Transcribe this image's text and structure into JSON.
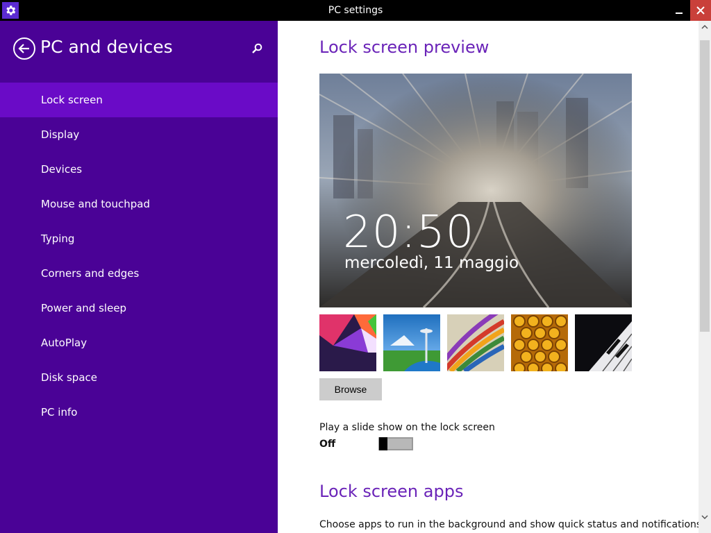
{
  "window": {
    "title": "PC settings",
    "icons": {
      "app": "gear-icon",
      "minimize": "minimize-icon",
      "close": "close-icon"
    }
  },
  "sidebar": {
    "title": "PC and devices",
    "back_icon": "back-arrow-icon",
    "search_icon": "search-icon",
    "items": [
      {
        "label": "Lock screen",
        "active": true
      },
      {
        "label": "Display"
      },
      {
        "label": "Devices"
      },
      {
        "label": "Mouse and touchpad"
      },
      {
        "label": "Typing"
      },
      {
        "label": "Corners and edges"
      },
      {
        "label": "Power and sleep"
      },
      {
        "label": "AutoPlay"
      },
      {
        "label": "Disk space"
      },
      {
        "label": "PC info"
      }
    ]
  },
  "main": {
    "preview_heading": "Lock screen preview",
    "preview": {
      "time": "20:50",
      "date": "mercoledì, 11 maggio"
    },
    "thumbnails": [
      "colorful-shapes",
      "space-needle",
      "color-stripes",
      "honeycomb",
      "piano-keys"
    ],
    "browse_label": "Browse",
    "slideshow_label": "Play a slide show on the lock screen",
    "slideshow_state": "Off",
    "slideshow_on": false,
    "apps_heading": "Lock screen apps",
    "apps_description": "Choose apps to run in the background and show quick status and notifications,"
  },
  "colors": {
    "sidebar_bg": "#4a0296",
    "sidebar_active": "#6a0bc7",
    "accent_heading": "#6a23b8",
    "close_button": "#c9403a"
  }
}
